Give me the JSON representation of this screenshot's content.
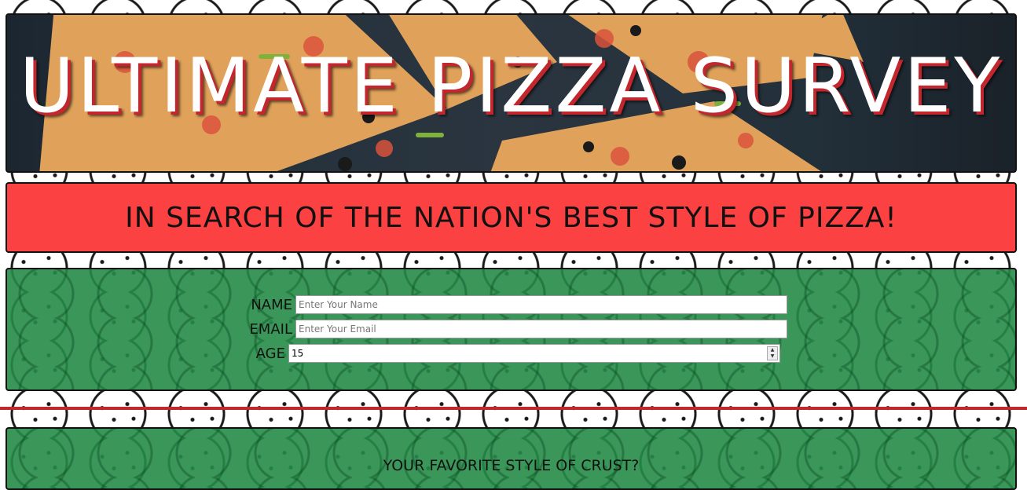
{
  "header": {
    "title": "ULTIMATE PIZZA SURVEY",
    "subtitle": "IN SEARCH OF THE NATION'S BEST STYLE OF PIZZA!"
  },
  "form": {
    "name": {
      "label": "NAME",
      "placeholder": "Enter Your Name",
      "value": ""
    },
    "email": {
      "label": "EMAIL",
      "placeholder": "Enter Your Email",
      "value": ""
    },
    "age": {
      "label": "AGE",
      "value": "15"
    }
  },
  "crust": {
    "question": "YOUR FAVORITE STYLE OF CRUST?"
  },
  "colors": {
    "title_shadow": "#c1272d",
    "subtitle_bar": "#fb4141",
    "form_panel": "#268b48",
    "divider": "#c1272d"
  },
  "icons": {
    "background_pattern": "pizza-and-mushroom-doodle",
    "age_stepper": "spinner-up-down-arrows"
  }
}
